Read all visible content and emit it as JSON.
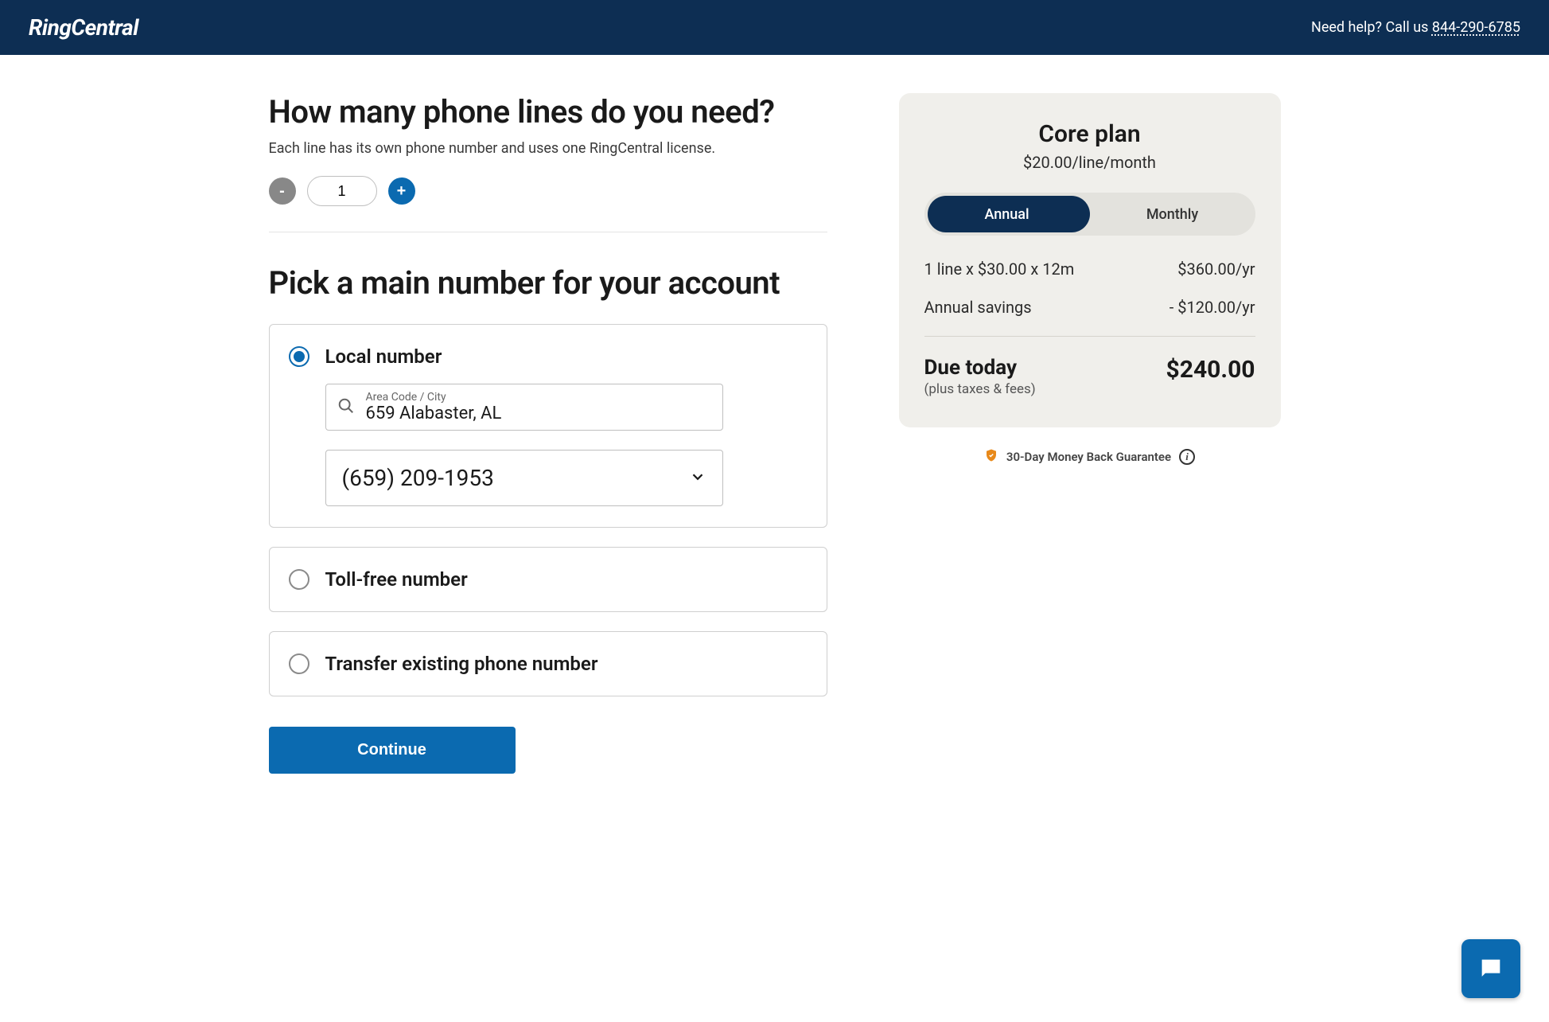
{
  "header": {
    "brand": "RingCentral",
    "help_text": "Need help? Call us ",
    "help_phone": "844-290-6785"
  },
  "lines": {
    "title": "How many phone lines do you need?",
    "subtitle": "Each line has its own phone number and uses one RingCentral license.",
    "minus": "-",
    "plus": "+",
    "value": "1"
  },
  "pick": {
    "title": "Pick a main number for your account",
    "options": {
      "local": {
        "label": "Local number",
        "search_small": "Area Code / City",
        "search_value": "659 Alabaster, AL",
        "selected_number": "(659) 209-1953"
      },
      "tollfree": {
        "label": "Toll-free number"
      },
      "transfer": {
        "label": "Transfer existing phone number"
      }
    }
  },
  "continue_label": "Continue",
  "summary": {
    "plan_name": "Core plan",
    "plan_price": "$20.00/line/month",
    "toggle": {
      "annual": "Annual",
      "monthly": "Monthly"
    },
    "line1": {
      "label": "1 line x $30.00 x 12m",
      "value": "$360.00/yr"
    },
    "line2": {
      "label": "Annual savings",
      "value": "- $120.00/yr"
    },
    "due_label": "Due today",
    "due_sub": "(plus taxes & fees)",
    "due_amount": "$240.00"
  },
  "guarantee": "30-Day Money Back Guarantee"
}
